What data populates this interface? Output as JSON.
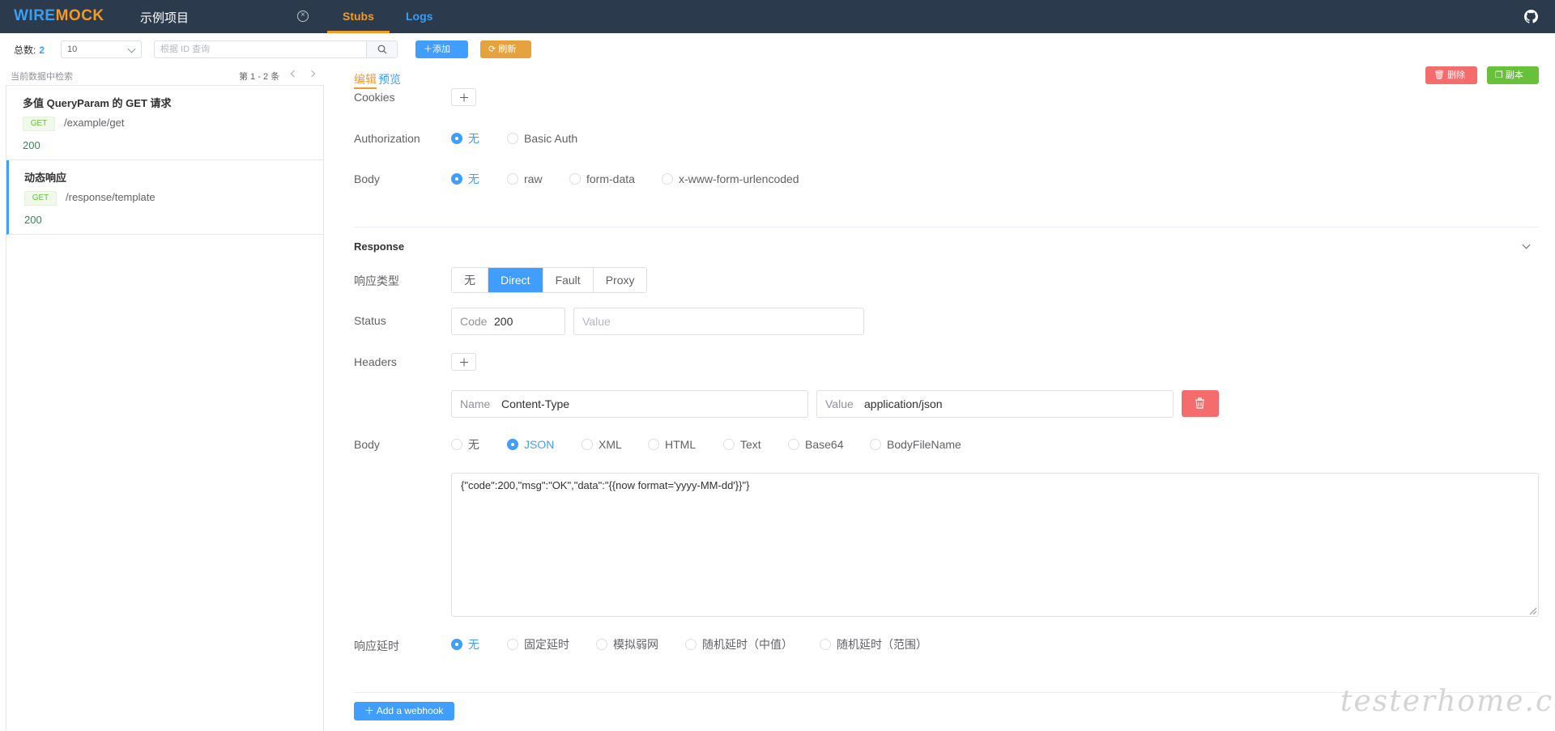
{
  "header": {
    "logo_part1": "WIRE",
    "logo_part2": "MOCK",
    "project_name": "示例项目",
    "tabs": [
      {
        "label": "Stubs",
        "active": true
      },
      {
        "label": "Logs",
        "active": false
      }
    ]
  },
  "toolbar": {
    "total_label": "总数:",
    "total_count": "2",
    "page_size": "10",
    "search_placeholder": "根据 ID 查询",
    "add_label": "添加",
    "refresh_label": "刷新"
  },
  "list": {
    "hint": "当前数据中检索",
    "pager": "第 1 - 2 条",
    "items": [
      {
        "title": "多值 QueryParam 的 GET 请求",
        "method": "GET",
        "url": "/example/get",
        "status": "200"
      },
      {
        "title": "动态响应",
        "method": "GET",
        "url": "/response/template",
        "status": "200",
        "active": true
      }
    ]
  },
  "editor": {
    "mode_edit": "编辑",
    "mode_preview": "预览",
    "delete_label": "删除",
    "copy_label": "副本",
    "request": {
      "cookies_label": "Cookies",
      "authorization_label": "Authorization",
      "auth_options": [
        "无",
        "Basic Auth"
      ],
      "body_label": "Body",
      "body_options": [
        "无",
        "raw",
        "form-data",
        "x-www-form-urlencoded"
      ]
    },
    "response": {
      "section_title": "Response",
      "type_label": "响应类型",
      "type_options": [
        "无",
        "Direct",
        "Fault",
        "Proxy"
      ],
      "type_selected": "Direct",
      "status_label": "Status",
      "status_code_prefix": "Code",
      "status_code": "200",
      "status_value_placeholder": "Value",
      "headers_label": "Headers",
      "header_name_prefix": "Name",
      "header_name": "Content-Type",
      "header_value_prefix": "Value",
      "header_value": "application/json",
      "body_label": "Body",
      "body_options": [
        "无",
        "JSON",
        "XML",
        "HTML",
        "Text",
        "Base64",
        "BodyFileName"
      ],
      "body_selected": "JSON",
      "body_content": "{\"code\":200,\"msg\":\"OK\",\"data\":\"{{now format='yyyy-MM-dd'}}\"}",
      "delay_label": "响应延时",
      "delay_options": [
        "无",
        "固定延时",
        "模拟弱网",
        "随机延时（中值）",
        "随机延时（范围）"
      ]
    },
    "webhook_label": "Add a webhook"
  },
  "watermark": "testerhome.com",
  "colors": {
    "topbar": "#2b3a4c",
    "accent_orange": "#f39a25",
    "primary": "#409eff",
    "danger": "#f56c6c",
    "success": "#67c23a"
  }
}
